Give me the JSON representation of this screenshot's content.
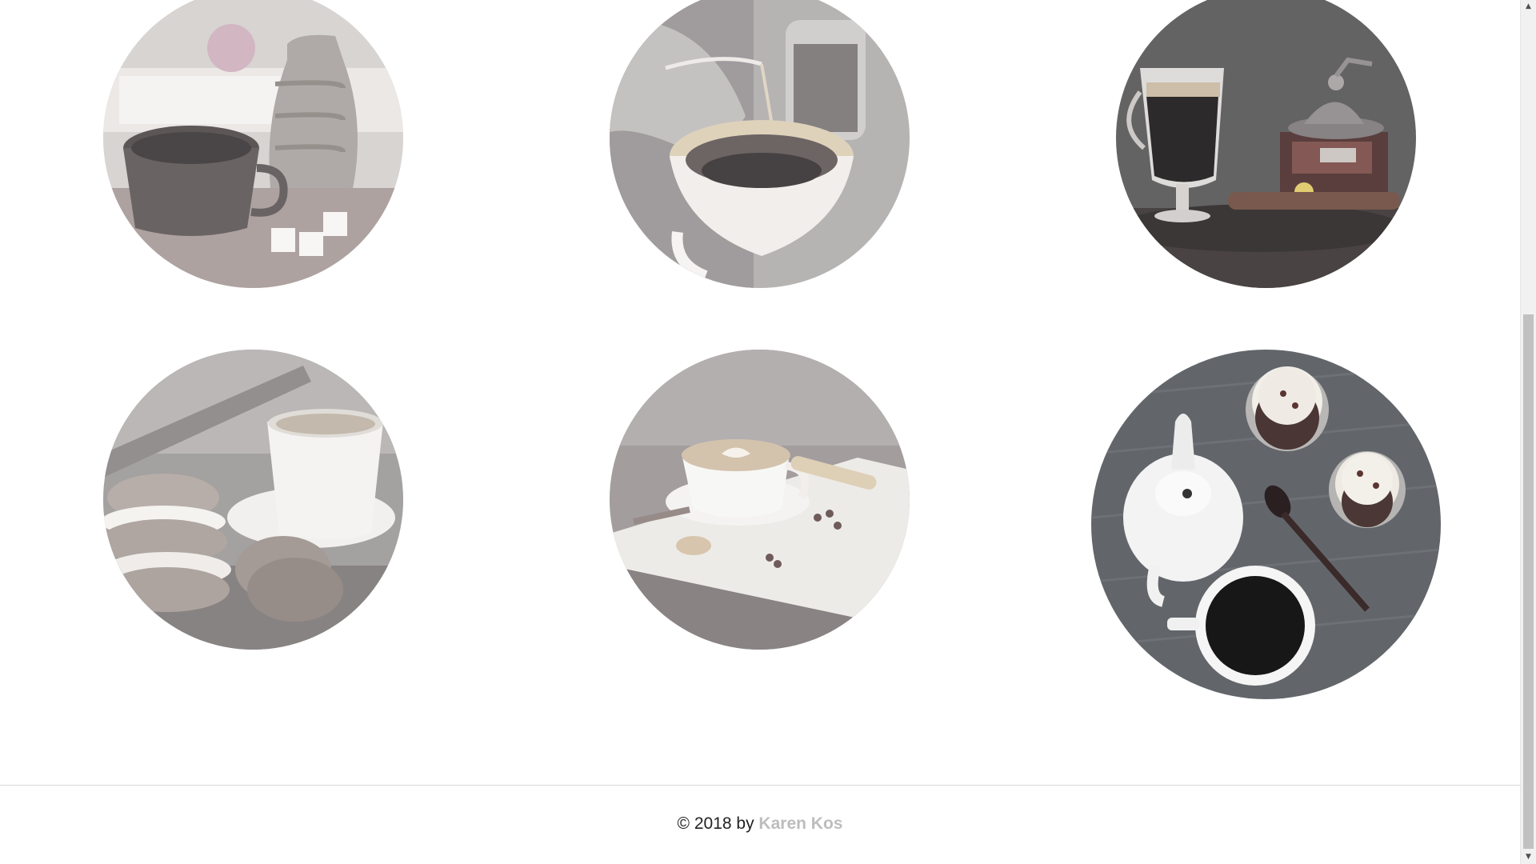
{
  "gallery": {
    "items": [
      {
        "icon": "coffee-cup-with-pitcher-photo"
      },
      {
        "icon": "pour-over-coffee-photo"
      },
      {
        "icon": "irish-coffee-and-grinder-photo"
      },
      {
        "icon": "macarons-and-coffee-photo"
      },
      {
        "icon": "latte-art-on-board-photo"
      },
      {
        "icon": "teapot-coffee-cupcakes-photo"
      }
    ]
  },
  "footer": {
    "prefix": "© 2018 by",
    "author": "Karen Kos",
    "link_color": "#bdbdbd"
  },
  "scrollbar": {
    "up_icon": "scroll-up-arrow-icon",
    "down_icon": "scroll-down-arrow-icon"
  }
}
